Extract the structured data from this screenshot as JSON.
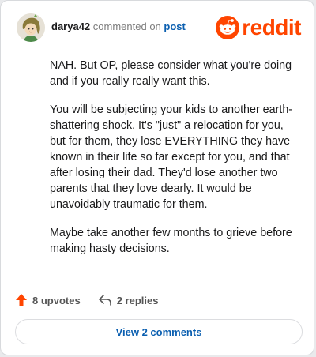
{
  "header": {
    "username": "darya42",
    "action_text": "commented on",
    "post_link": "post",
    "logo_text": "reddit"
  },
  "comment": {
    "paragraphs": [
      "NAH. But OP, please consider what you're doing and if you really really want this.",
      "You will be subjecting your kids to another earth-shattering shock. It's \"just\" a relocation for you, but for them, they lose EVERYTHING they have known in their life so far except for you, and that after losing their dad. They'd lose another two parents that they love dearly. It would be unavoidably traumatic for them.",
      "Maybe take another few months to grieve before making hasty decisions."
    ]
  },
  "actions": {
    "upvotes_label": "8 upvotes",
    "replies_label": "2 replies"
  },
  "footer": {
    "view_comments_label": "View 2 comments"
  },
  "colors": {
    "brand": "#ff4500",
    "link": "#0b5fb0"
  },
  "icons": {
    "upvote": "upvote-arrow-icon",
    "reply": "reply-arrow-icon",
    "logo": "reddit-snoo-icon"
  }
}
